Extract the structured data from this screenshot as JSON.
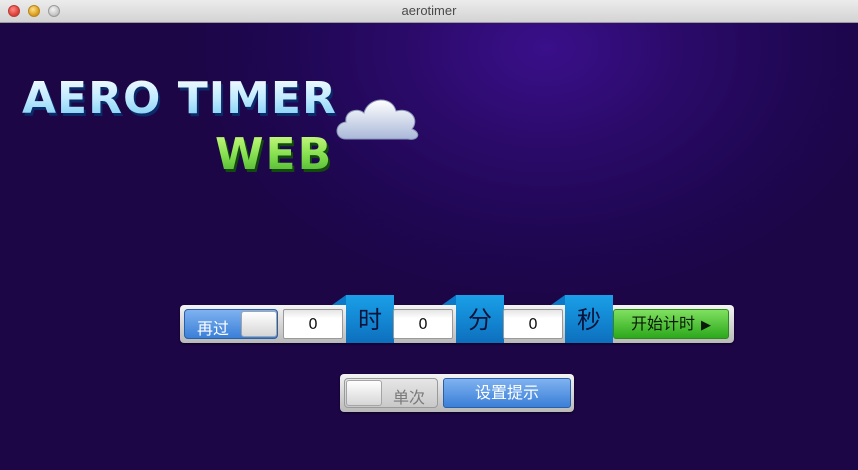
{
  "window": {
    "title": "aerotimer"
  },
  "logo": {
    "line1": "AERO TIMER",
    "line2": "WEB"
  },
  "timer": {
    "repeat_label": "再过",
    "hours_value": "0",
    "hours_unit": "时",
    "minutes_value": "0",
    "minutes_unit": "分",
    "seconds_value": "0",
    "seconds_unit": "秒",
    "start_label": "开始计时",
    "start_icon": "▶"
  },
  "bottom": {
    "once_label": "单次",
    "alert_label": "设置提示"
  },
  "colors": {
    "background": "#2a0a68",
    "accent_blue": "#1aa0e8",
    "start_green": "#2ca81c",
    "alert_blue": "#3a7fd8"
  }
}
